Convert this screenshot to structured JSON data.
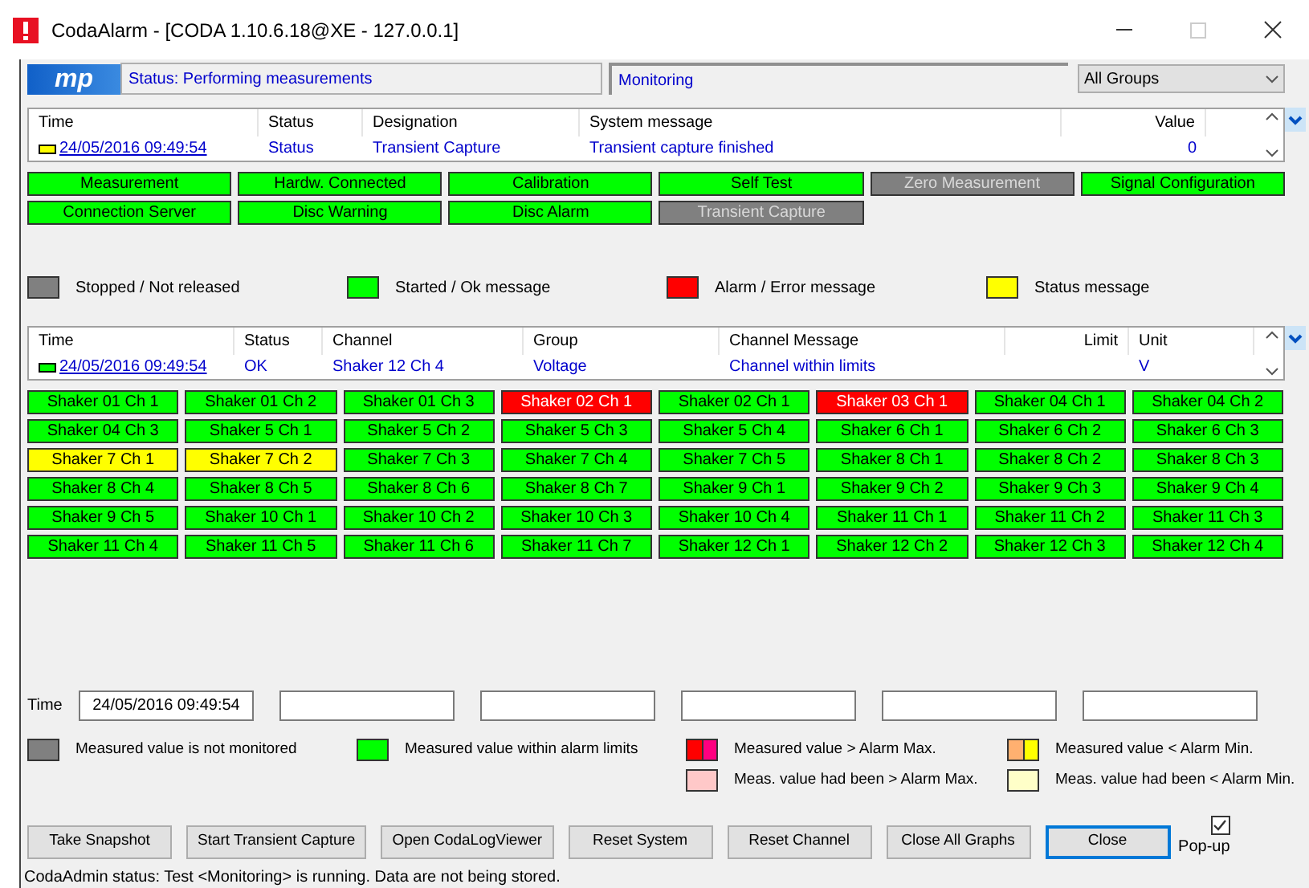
{
  "window": {
    "title": "CodaAlarm - [CODA 1.10.6.18@XE - 127.0.0.1]"
  },
  "header": {
    "logo": "mp",
    "status": "Status: Performing measurements",
    "mode": "Monitoring",
    "group_select": {
      "value": "All Groups"
    }
  },
  "system_table": {
    "columns": [
      "Time",
      "Status",
      "Designation",
      "System message",
      "Value"
    ],
    "rows": [
      {
        "color": "#ffff00",
        "cells": [
          "24/05/2016 09:49:54",
          "Status",
          "Transient Capture",
          "Transient capture finished",
          "0"
        ]
      }
    ]
  },
  "system_indicators": [
    {
      "label": "Measurement",
      "color": "#00ff00"
    },
    {
      "label": "Hardw. Connected",
      "color": "#00ff00"
    },
    {
      "label": "Calibration",
      "color": "#00ff00"
    },
    {
      "label": "Self Test",
      "color": "#00ff00"
    },
    {
      "label": "Zero Measurement",
      "color": "#808080"
    },
    {
      "label": "Signal Configuration",
      "color": "#00ff00"
    },
    {
      "label": "Connection Server",
      "color": "#00ff00"
    },
    {
      "label": "Disc Warning",
      "color": "#00ff00"
    },
    {
      "label": "Disc Alarm",
      "color": "#00ff00"
    },
    {
      "label": "Transient Capture",
      "color": "#808080"
    }
  ],
  "legend": [
    {
      "label": "Stopped / Not released",
      "color": "#808080"
    },
    {
      "label": "Started / Ok message",
      "color": "#00ff00"
    },
    {
      "label": "Alarm / Error message",
      "color": "#ff0000"
    },
    {
      "label": "Status message",
      "color": "#ffff00"
    }
  ],
  "channel_table": {
    "columns": [
      "Time",
      "Status",
      "Channel",
      "Group",
      "Channel Message",
      "Limit",
      "Unit"
    ],
    "rows": [
      {
        "color": "#00ff00",
        "cells": [
          "24/05/2016 09:49:54",
          "OK",
          "Shaker 12 Ch 4",
          "Voltage",
          "Channel within limits",
          "",
          "V"
        ]
      }
    ]
  },
  "channels": [
    {
      "label": "Shaker 01 Ch 1",
      "color": "#00ff00"
    },
    {
      "label": "Shaker 01 Ch 2",
      "color": "#00ff00"
    },
    {
      "label": "Shaker 01 Ch 3",
      "color": "#00ff00"
    },
    {
      "label": "Shaker 02 Ch 1",
      "color": "#ff0000"
    },
    {
      "label": "Shaker 02 Ch 1",
      "color": "#00ff00"
    },
    {
      "label": "Shaker 03 Ch 1",
      "color": "#ff0000"
    },
    {
      "label": "Shaker 04 Ch 1",
      "color": "#00ff00"
    },
    {
      "label": "Shaker 04 Ch 2",
      "color": "#00ff00"
    },
    {
      "label": "Shaker 04 Ch 3",
      "color": "#00ff00"
    },
    {
      "label": "Shaker 5 Ch 1",
      "color": "#00ff00"
    },
    {
      "label": "Shaker 5 Ch 2",
      "color": "#00ff00"
    },
    {
      "label": "Shaker 5 Ch 3",
      "color": "#00ff00"
    },
    {
      "label": "Shaker 5 Ch 4",
      "color": "#00ff00"
    },
    {
      "label": "Shaker 6 Ch 1",
      "color": "#00ff00"
    },
    {
      "label": "Shaker 6 Ch 2",
      "color": "#00ff00"
    },
    {
      "label": "Shaker 6 Ch 3",
      "color": "#00ff00"
    },
    {
      "label": "Shaker 7 Ch 1",
      "color": "#ffff00"
    },
    {
      "label": "Shaker 7 Ch 2",
      "color": "#ffff00"
    },
    {
      "label": "Shaker 7 Ch 3",
      "color": "#00ff00"
    },
    {
      "label": "Shaker 7 Ch 4",
      "color": "#00ff00"
    },
    {
      "label": "Shaker 7 Ch 5",
      "color": "#00ff00"
    },
    {
      "label": "Shaker 8 Ch 1",
      "color": "#00ff00"
    },
    {
      "label": "Shaker 8 Ch 2",
      "color": "#00ff00"
    },
    {
      "label": "Shaker 8 Ch 3",
      "color": "#00ff00"
    },
    {
      "label": "Shaker 8 Ch 4",
      "color": "#00ff00"
    },
    {
      "label": "Shaker 8 Ch 5",
      "color": "#00ff00"
    },
    {
      "label": "Shaker 8 Ch 6",
      "color": "#00ff00"
    },
    {
      "label": "Shaker 8 Ch 7",
      "color": "#00ff00"
    },
    {
      "label": "Shaker 9 Ch 1",
      "color": "#00ff00"
    },
    {
      "label": "Shaker 9 Ch 2",
      "color": "#00ff00"
    },
    {
      "label": "Shaker 9 Ch 3",
      "color": "#00ff00"
    },
    {
      "label": "Shaker 9 Ch 4",
      "color": "#00ff00"
    },
    {
      "label": "Shaker 9 Ch 5",
      "color": "#00ff00"
    },
    {
      "label": "Shaker 10 Ch 1",
      "color": "#00ff00"
    },
    {
      "label": "Shaker 10 Ch 2",
      "color": "#00ff00"
    },
    {
      "label": "Shaker 10 Ch 3",
      "color": "#00ff00"
    },
    {
      "label": "Shaker 10 Ch 4",
      "color": "#00ff00"
    },
    {
      "label": "Shaker 11 Ch 1",
      "color": "#00ff00"
    },
    {
      "label": "Shaker 11 Ch 2",
      "color": "#00ff00"
    },
    {
      "label": "Shaker 11 Ch 3",
      "color": "#00ff00"
    },
    {
      "label": "Shaker 11 Ch 4",
      "color": "#00ff00"
    },
    {
      "label": "Shaker 11 Ch 5",
      "color": "#00ff00"
    },
    {
      "label": "Shaker 11 Ch 6",
      "color": "#00ff00"
    },
    {
      "label": "Shaker 11 Ch 7",
      "color": "#00ff00"
    },
    {
      "label": "Shaker 12 Ch 1",
      "color": "#00ff00"
    },
    {
      "label": "Shaker 12 Ch 2",
      "color": "#00ff00"
    },
    {
      "label": "Shaker 12 Ch 3",
      "color": "#00ff00"
    },
    {
      "label": "Shaker 12 Ch 4",
      "color": "#00ff00"
    }
  ],
  "time_row": {
    "label": "Time",
    "value": "24/05/2016 09:49:54"
  },
  "value_legend": [
    {
      "label": "Measured value is not monitored",
      "swatches": [
        {
          "color": "#808080"
        }
      ]
    },
    {
      "label": "Measured value within alarm limits",
      "swatches": [
        {
          "color": "#00ff00"
        }
      ]
    },
    {
      "label": "Measured value > Alarm Max.",
      "swatches": [
        {
          "color": "#ff0000"
        },
        {
          "color": "#ff0080"
        }
      ]
    },
    {
      "label": "Measured value < Alarm Min.",
      "swatches": [
        {
          "color": "#ffb070"
        },
        {
          "color": "#ffff00"
        }
      ]
    },
    {
      "label": "Meas. value had been > Alarm Max.",
      "swatches": [
        {
          "color": "#ffc8c8"
        }
      ]
    },
    {
      "label": "Meas. value had been < Alarm Min.",
      "swatches": [
        {
          "color": "#ffffc8"
        }
      ]
    }
  ],
  "buttons": [
    {
      "label": "Take Snapshot",
      "focused": false
    },
    {
      "label": "Start Transient Capture",
      "focused": false
    },
    {
      "label": "Open CodaLogViewer",
      "focused": false
    },
    {
      "label": "Reset System",
      "focused": false
    },
    {
      "label": "Reset Channel",
      "focused": false
    },
    {
      "label": "Close All Graphs",
      "focused": false
    },
    {
      "label": "Close",
      "focused": true
    }
  ],
  "popup": {
    "label": "Pop-up",
    "checked": true
  },
  "status_bar": "CodaAdmin status: Test <Monitoring> is running. Data are not being stored."
}
